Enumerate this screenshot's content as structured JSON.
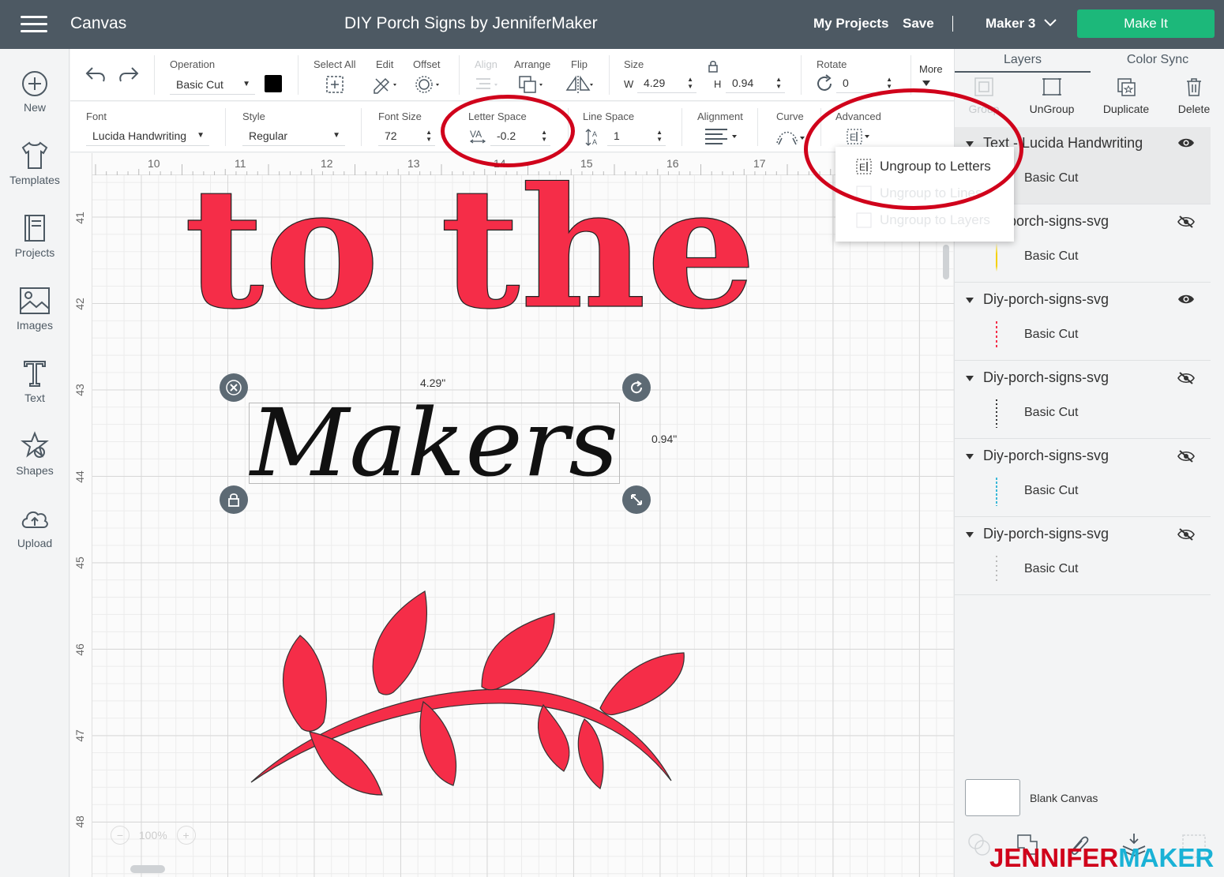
{
  "topbar": {
    "app_title": "Canvas",
    "project_title": "DIY Porch Signs by JenniferMaker",
    "my_projects": "My Projects",
    "save": "Save",
    "machine": "Maker 3",
    "make_it": "Make It"
  },
  "leftnav": [
    {
      "label": "New",
      "icon": "plus-circle-icon"
    },
    {
      "label": "Templates",
      "icon": "tshirt-icon"
    },
    {
      "label": "Projects",
      "icon": "book-icon"
    },
    {
      "label": "Images",
      "icon": "image-icon"
    },
    {
      "label": "Text",
      "icon": "text-t-icon"
    },
    {
      "label": "Shapes",
      "icon": "shapes-icon"
    },
    {
      "label": "Upload",
      "icon": "cloud-upload-icon"
    }
  ],
  "toolbar1": {
    "operation_label": "Operation",
    "operation_value": "Basic Cut",
    "select_all": "Select All",
    "edit": "Edit",
    "offset": "Offset",
    "align": "Align",
    "arrange": "Arrange",
    "flip": "Flip",
    "size_label": "Size",
    "w_label": "W",
    "w_value": "4.29",
    "h_label": "H",
    "h_value": "0.94",
    "rotate_label": "Rotate",
    "rotate_value": "0",
    "more": "More",
    "color_swatch": "#000000"
  },
  "toolbar2": {
    "font_label": "Font",
    "font_value": "Lucida Handwriting",
    "style_label": "Style",
    "style_value": "Regular",
    "font_size_label": "Font Size",
    "font_size_value": "72",
    "letter_space_label": "Letter Space",
    "letter_space_value": "-0.2",
    "line_space_label": "Line Space",
    "line_space_value": "1",
    "alignment_label": "Alignment",
    "curve_label": "Curve",
    "advanced_label": "Advanced"
  },
  "advanced_menu": [
    {
      "label": "Ungroup to Letters",
      "enabled": true
    },
    {
      "label": "Ungroup to Lines",
      "enabled": false
    },
    {
      "label": "Ungroup to Layers",
      "enabled": false
    }
  ],
  "ruler": {
    "top": [
      "10",
      "11",
      "12",
      "13",
      "14",
      "15",
      "16",
      "17"
    ],
    "left": [
      "41",
      "42",
      "43",
      "44",
      "45",
      "46",
      "47",
      "48"
    ]
  },
  "canvas": {
    "headline": "to the",
    "selected_text": "Makers",
    "width_readout": "4.29\"",
    "height_readout": "0.94\"",
    "zoom": "100%",
    "accent": "#f52d48"
  },
  "rpanel": {
    "tabs": [
      "Layers",
      "Color Sync"
    ],
    "tools": [
      "Group",
      "UnGroup",
      "Duplicate",
      "Delete"
    ],
    "layers": [
      {
        "title": "Text - Lucida Handwriting",
        "sub": "Basic Cut",
        "visible": true,
        "thumb": "#333333"
      },
      {
        "title": "Diy-porch-signs-svg",
        "sub": "Basic Cut",
        "visible": false,
        "thumb": "#f5d000"
      },
      {
        "title": "Diy-porch-signs-svg",
        "sub": "Basic Cut",
        "visible": true,
        "thumb": "#f52d48"
      },
      {
        "title": "Diy-porch-signs-svg",
        "sub": "Basic Cut",
        "visible": false,
        "thumb": "#333333"
      },
      {
        "title": "Diy-porch-signs-svg",
        "sub": "Basic Cut",
        "visible": false,
        "thumb": "#3ab8d8"
      },
      {
        "title": "Diy-porch-signs-svg",
        "sub": "Basic Cut",
        "visible": false,
        "thumb": "#cccccc"
      }
    ],
    "blank_canvas": "Blank Canvas",
    "bottom_tools": [
      "Slice",
      "Weld",
      "Attach",
      "Flatten",
      "Contour"
    ]
  },
  "watermark": {
    "part1": "JENNIFER",
    "part2": "MAKER"
  }
}
